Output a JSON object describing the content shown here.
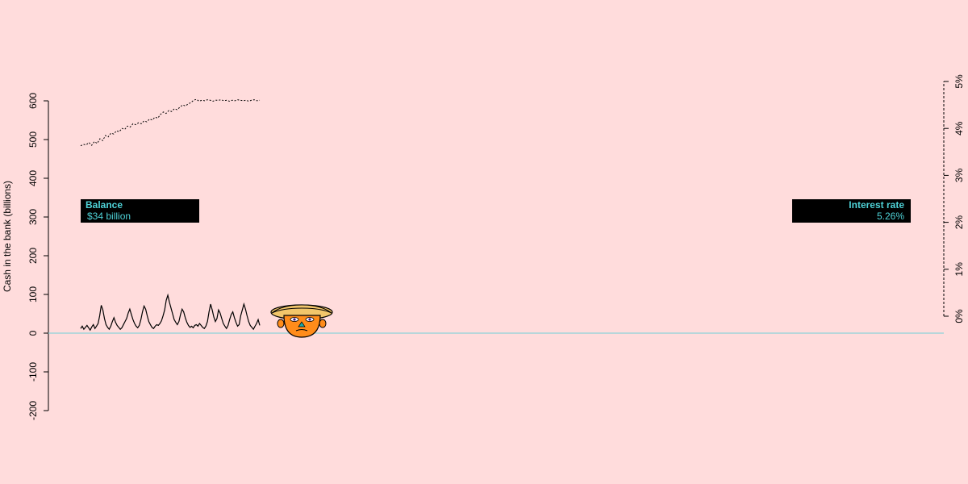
{
  "colors": {
    "background": "#ffdcdc",
    "zero_line": "#9fd4da",
    "box_bg": "#000000",
    "box_text": "#4fd3d8",
    "line": "#000000"
  },
  "info_boxes": {
    "balance": {
      "title": "Balance",
      "value": "$34 billion"
    },
    "interest_rate": {
      "title": "Interest rate",
      "value": "5.26%"
    }
  },
  "chart_data": {
    "type": "line",
    "title": "",
    "xlabel": "",
    "ylabel": "Cash in the bank (billions)",
    "ylim": [
      -200,
      600
    ],
    "y_ticks": [
      -200,
      -100,
      0,
      100,
      200,
      300,
      400,
      500,
      600
    ],
    "y_tick_labels": [
      "-200",
      "-100",
      "0",
      "100",
      "200",
      "300",
      "400",
      "500",
      "600"
    ],
    "y2_ticks": [
      0,
      1,
      2,
      3,
      4,
      5
    ],
    "y2_tick_labels": [
      "0%",
      "1%",
      "2%",
      "3%",
      "4%",
      "5%"
    ],
    "y2lim": [
      0,
      5
    ],
    "grid": false,
    "series": [
      {
        "axis": "left",
        "style": "solid",
        "values": [
          12,
          18,
          10,
          15,
          20,
          14,
          8,
          16,
          22,
          12,
          18,
          25,
          45,
          72,
          60,
          38,
          22,
          15,
          10,
          18,
          30,
          40,
          28,
          20,
          15,
          10,
          14,
          22,
          30,
          38,
          52,
          62,
          48,
          35,
          25,
          18,
          14,
          20,
          35,
          55,
          70,
          62,
          45,
          30,
          22,
          15,
          12,
          18,
          22,
          20,
          25,
          32,
          45,
          60,
          85,
          98,
          80,
          65,
          50,
          35,
          28,
          22,
          30,
          48,
          62,
          55,
          40,
          28,
          20,
          15,
          18,
          14,
          20,
          22,
          18,
          25,
          20,
          15,
          12,
          18,
          30,
          55,
          75,
          60,
          42,
          30,
          38,
          60,
          52,
          38,
          25,
          18,
          12,
          20,
          35,
          48,
          55,
          40,
          28,
          18,
          22,
          45,
          60,
          75,
          62,
          45,
          30,
          20,
          15,
          10,
          18,
          25,
          35,
          20
        ]
      },
      {
        "axis": "right",
        "style": "dashed",
        "values": [
          3.63,
          3.66,
          3.65,
          3.7,
          3.64,
          3.72,
          3.68,
          3.78,
          3.74,
          3.85,
          3.82,
          3.9,
          3.88,
          3.95,
          3.93,
          4.0,
          3.98,
          4.05,
          4.03,
          4.1,
          4.08,
          4.12,
          4.1,
          4.16,
          4.14,
          4.2,
          4.18,
          4.24,
          4.22,
          4.3,
          4.35,
          4.32,
          4.38,
          4.36,
          4.42,
          4.4,
          4.45,
          4.5,
          4.48,
          4.52,
          4.55,
          4.6,
          4.62,
          4.58,
          4.6,
          4.59,
          4.61,
          4.6,
          4.58,
          4.6,
          4.6,
          4.61,
          4.59,
          4.6,
          4.58,
          4.6,
          4.59,
          4.61,
          4.6,
          4.59,
          4.6,
          4.58,
          4.6,
          4.61,
          4.59,
          4.6
        ]
      }
    ]
  }
}
